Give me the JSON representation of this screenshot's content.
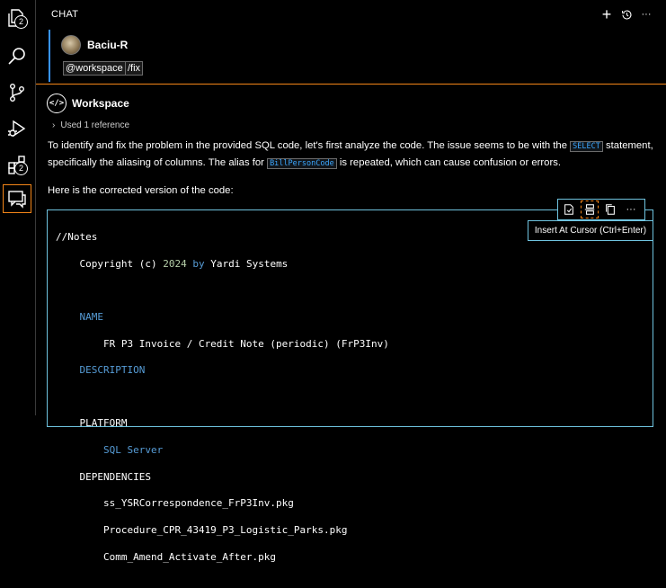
{
  "activity_bar": {
    "explorer_badge": "2",
    "extensions_badge": "2"
  },
  "chat": {
    "header_title": "CHAT",
    "new_chat_glyph": "+",
    "more_glyph": "···"
  },
  "request": {
    "username": "Baciu-R",
    "chips": [
      "@workspace",
      "/fix"
    ]
  },
  "response": {
    "agent_name": "Workspace",
    "agent_icon_glyph": "</>",
    "used_references": "Used 1 reference",
    "para1_part1": "To identify and fix the problem in the provided SQL code, let's first analyze the code. The issue seems to be with the ",
    "para1_code1": "SELECT",
    "para1_part2": " statement, specifically the aliasing of columns. The alias for ",
    "para1_code2": "BillPersonCode",
    "para1_part3": " is repeated, which can cause confusion or errors.",
    "para2": "Here is the corrected version of the code:"
  },
  "code_toolbar": {
    "more_glyph": "···",
    "tooltip": "Insert At Cursor (Ctrl+Enter)"
  },
  "code": {
    "l1": "//Notes",
    "l2_a": "    Copyright ",
    "l2_b": "(c)",
    "l2_c": " ",
    "l2_d": "2024",
    "l2_e": " ",
    "l2_f": "by",
    "l2_g": " Yardi Systems",
    "l4": "    NAME",
    "l5_a": "        FR P3 Invoice / Credit Note ",
    "l5_b": "(periodic)",
    "l5_c": " (FrP3Inv)",
    "l6": "    DESCRIPTION",
    "l8": "    PLATFORM",
    "l9": "        SQL Server",
    "l10": "    DEPENDENCIES",
    "l11": "        ss_YSRCorrespondence_FrP3Inv.pkg",
    "l12": "        Procedure_CPR_43419_P3_Logistic_Parks.pkg",
    "l13": "        Comm_Amend_Activate_After.pkg"
  }
}
